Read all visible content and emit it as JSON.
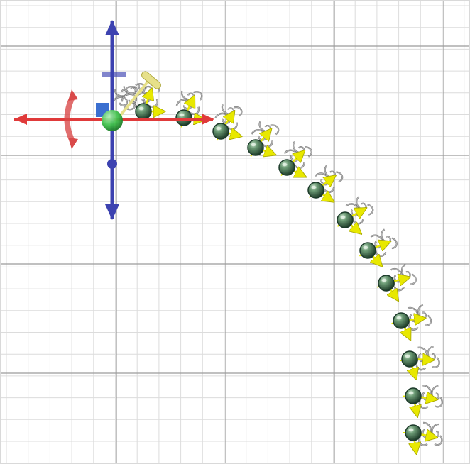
{
  "viewport": {
    "background_color": "#ffffff",
    "grid_minor_color": "#dcdcdc",
    "grid_major_color": "#9a9a9a",
    "frame_color": "#d0d0d0"
  },
  "gizmo": {
    "x_axis_color": "#e03a3a",
    "y_axis_color": "#3c42b0",
    "rotation_handle_color": "#d94a4a",
    "center_handle_color": "#3fbf4a",
    "plane_handle_color": "#3b6fd0",
    "scale_handle_color": "#e6e08a"
  },
  "curve": {
    "control_point_count": 15,
    "control_point_color": "#3f6b4d",
    "control_point_outline_color": "#1c3a2a",
    "normal_arrow_color": "#e8e800",
    "ornament_color": "#b7b7b7",
    "ornament_outline_color": "#555555"
  },
  "icons": {
    "move_x": "arrow-right-icon",
    "move_y": "arrow-up-icon",
    "rotate": "rotate-arc-icon",
    "scale": "scale-handle-icon",
    "center": "center-sphere-icon"
  }
}
